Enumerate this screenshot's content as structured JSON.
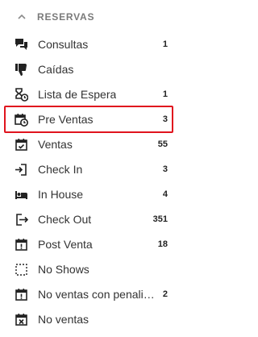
{
  "section": {
    "title": "RESERVAS",
    "collapse_icon": "chevron-up-icon"
  },
  "items": [
    {
      "label": "Consultas",
      "count": "1",
      "icon": "chat-icon"
    },
    {
      "label": "Caídas",
      "count": "",
      "icon": "thumbs-down-icon"
    },
    {
      "label": "Lista de Espera",
      "count": "1",
      "icon": "hourglass-icon"
    },
    {
      "label": "Pre Ventas",
      "count": "3",
      "icon": "calendar-clock-icon",
      "selected": true
    },
    {
      "label": "Ventas",
      "count": "55",
      "icon": "calendar-check-icon"
    },
    {
      "label": "Check In",
      "count": "3",
      "icon": "sign-in-icon"
    },
    {
      "label": "In House",
      "count": "4",
      "icon": "bed-icon"
    },
    {
      "label": "Check Out",
      "count": "351",
      "icon": "sign-out-icon"
    },
    {
      "label": "Post Venta",
      "count": "18",
      "icon": "calendar-exclamation-icon"
    },
    {
      "label": "No Shows",
      "count": "",
      "icon": "dashed-square-icon"
    },
    {
      "label": "No ventas con penalid...",
      "count": "2",
      "icon": "calendar-exclamation-icon"
    },
    {
      "label": "No ventas",
      "count": "",
      "icon": "calendar-x-icon"
    }
  ],
  "colors": {
    "highlight": "#e0141e",
    "section_title": "#7a7a7a"
  }
}
